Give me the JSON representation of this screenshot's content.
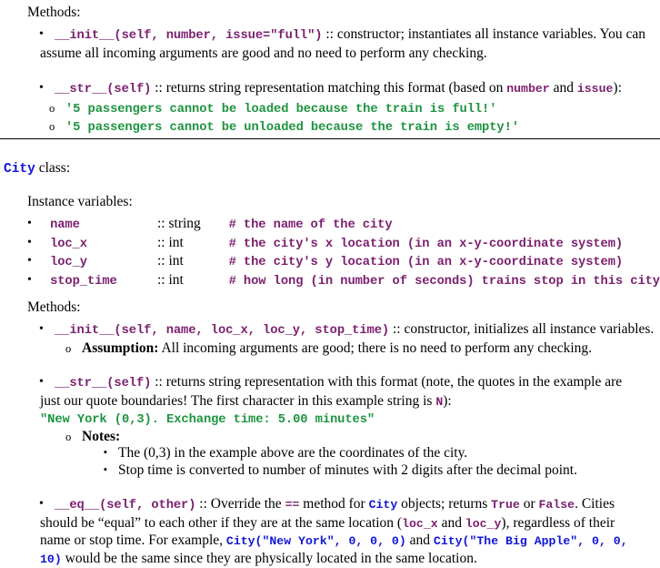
{
  "colors": {
    "code_purple": "#7B1F6E",
    "string_green": "#1E9440",
    "class_blue": "#1116D6",
    "text_black": "#000000"
  },
  "train_section": {
    "methods_heading": "Methods:",
    "init": {
      "signature": "__init__(self, number, issue=\"full\")",
      "separator": " :: ",
      "description_line1": "constructor; instantiates all instance variables.  You can",
      "description_line2": "assume all incoming arguments are good and no need to perform any checking."
    },
    "str": {
      "signature": "__str__(self)",
      "separator": " :: ",
      "desc_a": "returns string representation matching this format (based on ",
      "ref_number": "number",
      "desc_b": " and ",
      "ref_issue": "issue",
      "desc_c": "):",
      "examples": [
        "'5 passengers cannot be loaded because the train is full!'",
        "'5 passengers cannot be unloaded because the train is empty!'"
      ]
    }
  },
  "city_section": {
    "class_name": "City",
    "class_suffix": " class:",
    "instance_variables_heading": "Instance variables:",
    "instance_variables": [
      {
        "name": "name",
        "type": ":: string",
        "comment": "# the name of the city"
      },
      {
        "name": "loc_x",
        "type": ":: int",
        "comment": "# the city's x location (in an x-y-coordinate system)"
      },
      {
        "name": "loc_y",
        "type": ":: int",
        "comment": "# the city's y location (in an x-y-coordinate system)"
      },
      {
        "name": "stop_time",
        "type": ":: int",
        "comment": "# how long (in number of seconds) trains stop in this city"
      }
    ],
    "methods_heading": "Methods:",
    "init": {
      "signature": "__init__(self, name, loc_x, loc_y, stop_time)",
      "separator": " :: ",
      "description": "constructor, initializes all instance variables.",
      "assumption_label": "Assumption:",
      "assumption_text": " All incoming arguments are good; there is no need to perform any checking."
    },
    "str": {
      "signature": "__str__(self)",
      "separator": " :: ",
      "desc_line1": "returns string representation with this format (note, the quotes in the example are",
      "desc_line2a": "just our quote boundaries! The first character in this example string is ",
      "desc_line2_code": "N",
      "desc_line2b": "):",
      "example": "\"New York (0,3). Exchange time: 5.00 minutes\"",
      "notes_label": "Notes:",
      "notes": [
        "The (0,3) in the example above are the coordinates of the city.",
        "Stop time is converted to number of minutes with 2 digits after the decimal point."
      ]
    },
    "eq": {
      "signature": "__eq__(self, other)",
      "separator": " :: ",
      "t1": "Override the ",
      "op": "==",
      "t2": " method for ",
      "cls": "City",
      "t3": " objects; returns ",
      "true_val": "True",
      "t4": " or ",
      "false_val": "False",
      "t5": ". Cities",
      "line2a": "should be “equal” to each other if they are at the same location (",
      "line2_codeA": "loc_x",
      "line2b": " and ",
      "line2_codeB": "loc_y",
      "line2c": "), regardless of their",
      "line3a": "name or stop time. For example, ",
      "line3_codeA": "City(\"New York\", 0, 0, 0)",
      "line3b": " and ",
      "line3_codeB": "City(\"The Big Apple\", 0, 0,",
      "line4_codeC": "10)",
      "line4": " would be the same since they are physically located in the same location."
    }
  }
}
